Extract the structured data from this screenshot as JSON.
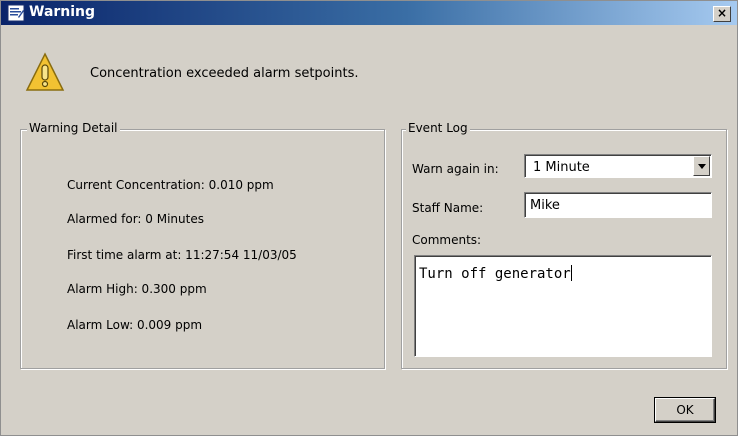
{
  "window": {
    "title": "Warning",
    "close_label": "×"
  },
  "alert": {
    "message": "Concentration exceeded alarm setpoints."
  },
  "warning_detail": {
    "legend": "Warning Detail",
    "lines": [
      "Current Concentration: 0.010 ppm",
      "Alarmed for: 0 Minutes",
      "First time alarm at: 11:27:54 11/03/05",
      "Alarm High: 0.300 ppm",
      "Alarm Low: 0.009 ppm"
    ]
  },
  "event_log": {
    "legend": "Event Log",
    "warn_again_label": "Warn again in:",
    "warn_again_value": "1 Minute",
    "staff_name_label": "Staff Name:",
    "staff_name_value": "Mike",
    "comments_label": "Comments:",
    "comments_value": "Turn off generator"
  },
  "buttons": {
    "ok_label": "OK"
  },
  "icons": {
    "title": "app-icon",
    "alert": "warning-icon",
    "dropdown": "chevron-down-icon"
  }
}
